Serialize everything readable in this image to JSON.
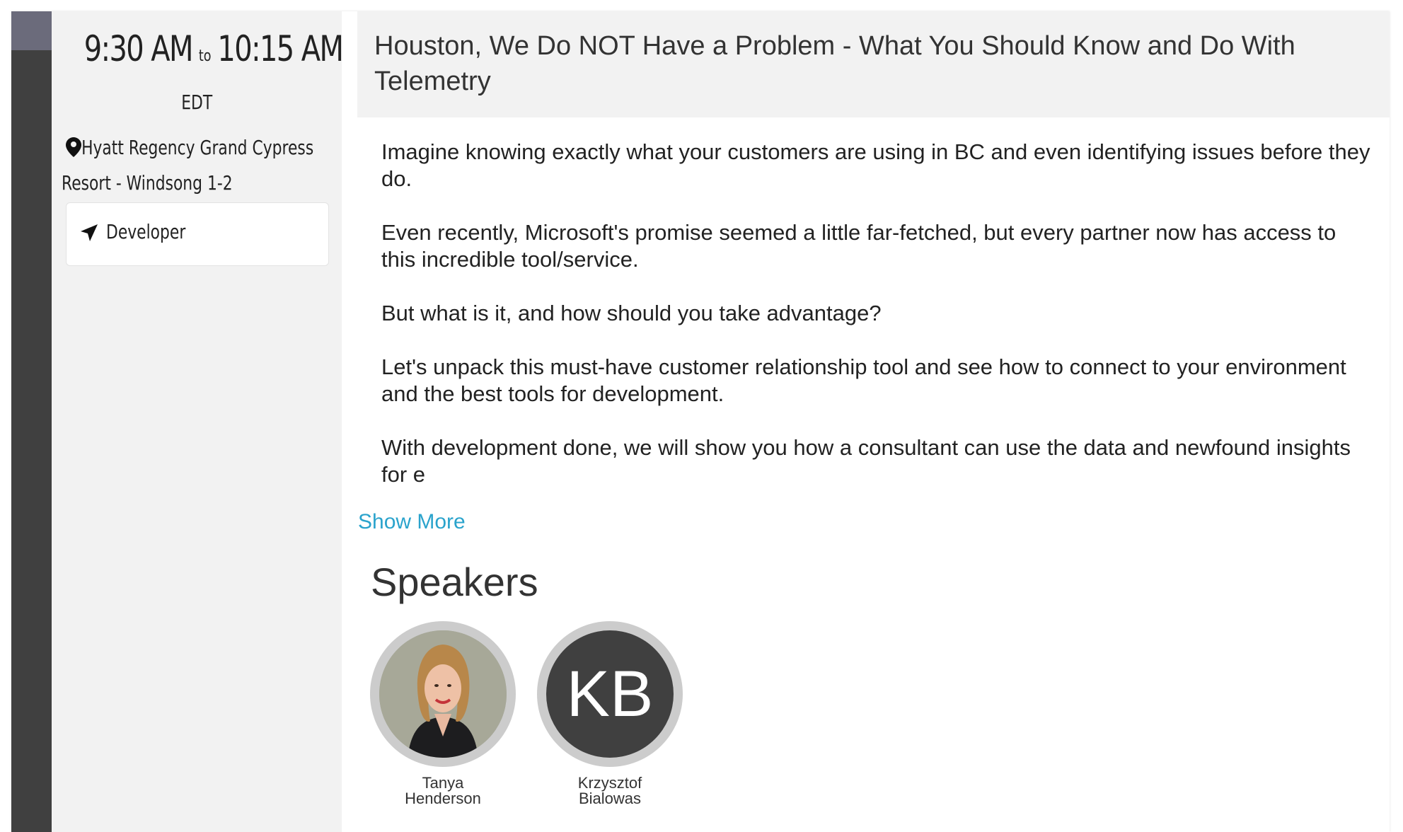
{
  "session": {
    "start_time": "9:30 AM",
    "to_label": "to",
    "end_time": "10:15 AM",
    "timezone": "EDT",
    "location_line1": "Hyatt Regency Grand Cypress",
    "location_line2": "Resort - Windsong 1-2",
    "track": "Developer",
    "title": "Houston, We Do NOT Have a Problem - What You Should Know and Do With Telemetry",
    "description": [
      "Imagine knowing exactly what your customers are using in BC and even identifying issues before they do.",
      "Even recently, Microsoft's promise seemed a little far-fetched, but every partner now has access to this incredible tool/service.",
      "But what is it, and how should you take advantage?",
      "Let's unpack this must-have customer relationship tool and see how to connect to your environment and the best tools for development.",
      "With development done, we will show you how a consultant can use the data and newfound insights for e"
    ],
    "show_more_label": "Show More"
  },
  "speakers": {
    "heading": "Speakers",
    "items": [
      {
        "first": "Tanya",
        "last": "Henderson",
        "initials": "",
        "avatar": "photo"
      },
      {
        "first": "Krzysztof",
        "last": "Bialowas",
        "initials": "KB",
        "avatar": "initials"
      }
    ]
  },
  "colors": {
    "accent_bar": "#404040",
    "accent_cap": "#6b6b7b",
    "panel_bg": "#f2f2f2",
    "link": "#2aa3cc",
    "avatar_ring": "#cccccc",
    "initials_bg": "#404040"
  },
  "icons": {
    "location": "map-pin-icon",
    "track": "navigation-arrow-icon"
  }
}
